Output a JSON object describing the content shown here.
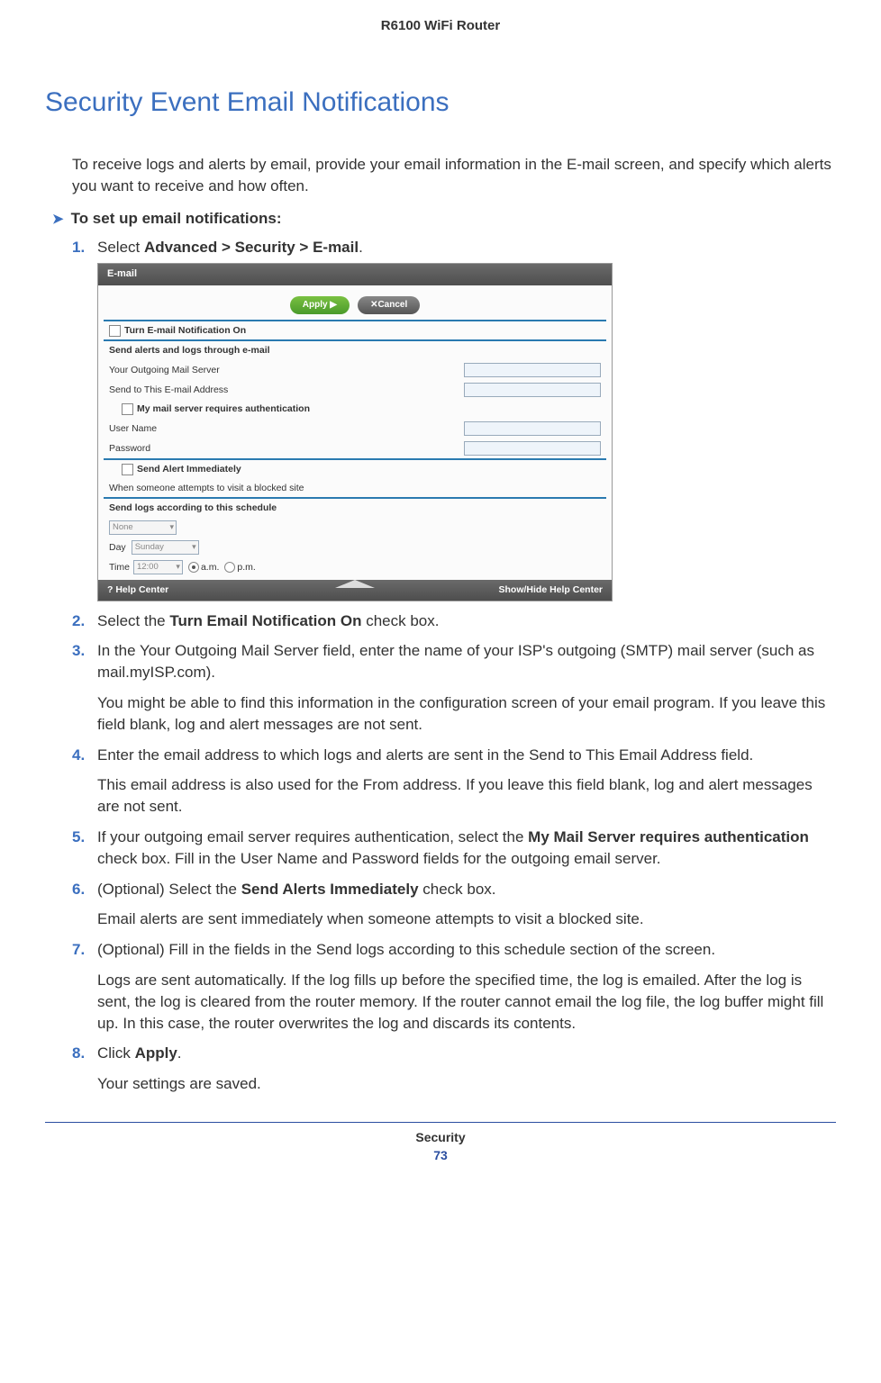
{
  "header": "R6100 WiFi Router",
  "h1": "Security Event Email Notifications",
  "intro": "To receive logs and alerts by email, provide your email information in the E-mail screen, and specify which alerts you want to receive and how often.",
  "proc_heading": "To set up email notifications:",
  "steps": {
    "s1_a": "Select ",
    "s1_b": "Advanced > Security > E-mail",
    "s1_c": ".",
    "s2_a": "Select the ",
    "s2_b": "Turn Email Notification On",
    "s2_c": " check box.",
    "s3": "In the Your Outgoing Mail Server field, enter the name of your ISP's outgoing (SMTP) mail server (such as mail.myISP.com).",
    "s3_p": "You might be able to find this information in the configuration screen of your email program. If you leave this field blank, log and alert messages are not sent.",
    "s4": "Enter the email address to which logs and alerts are sent in the Send to This Email Address field.",
    "s4_p": "This email address is also used for the From address. If you leave this field blank, log and alert messages are not sent.",
    "s5_a": "If your outgoing email server requires authentication, select the ",
    "s5_b": "My Mail Server requires authentication",
    "s5_c": " check box. Fill in the User Name and Password fields for the outgoing email server.",
    "s6_a": "(Optional) Select the ",
    "s6_b": "Send Alerts Immediately",
    "s6_c": " check box.",
    "s6_p": "Email alerts are sent immediately when someone attempts to visit a blocked site.",
    "s7": "(Optional) Fill in the fields in the Send logs according to this schedule section of the screen.",
    "s7_p": "Logs are sent automatically. If the log fills up before the specified time, the log is emailed. After the log is sent, the log is cleared from the router memory. If the router cannot email the log file, the log buffer might fill up. In this case, the router overwrites the log and discards its contents.",
    "s8_a": "Click ",
    "s8_b": "Apply",
    "s8_c": ".",
    "s8_p": "Your settings are saved."
  },
  "screenshot": {
    "title": "E-mail",
    "apply": "Apply ▶",
    "cancel": "✕Cancel",
    "turn_on": "Turn E-mail Notification On",
    "section1": "Send alerts and logs through e-mail",
    "outgoing": "Your Outgoing Mail Server",
    "sendto": "Send to This E-mail Address",
    "auth": "My mail server requires authentication",
    "user": "User Name",
    "pass": "Password",
    "alert_imm": "Send Alert Immediately",
    "alert_desc": "When someone attempts to visit a blocked site",
    "schedule": "Send logs according to this schedule",
    "none": "None",
    "day_lbl": "Day",
    "day_val": "Sunday",
    "time_lbl": "Time",
    "time_val": "12:00",
    "am": "a.m.",
    "pm": "p.m.",
    "help": "? Help Center",
    "showhide": "Show/Hide Help Center"
  },
  "footer": {
    "section": "Security",
    "page": "73"
  }
}
